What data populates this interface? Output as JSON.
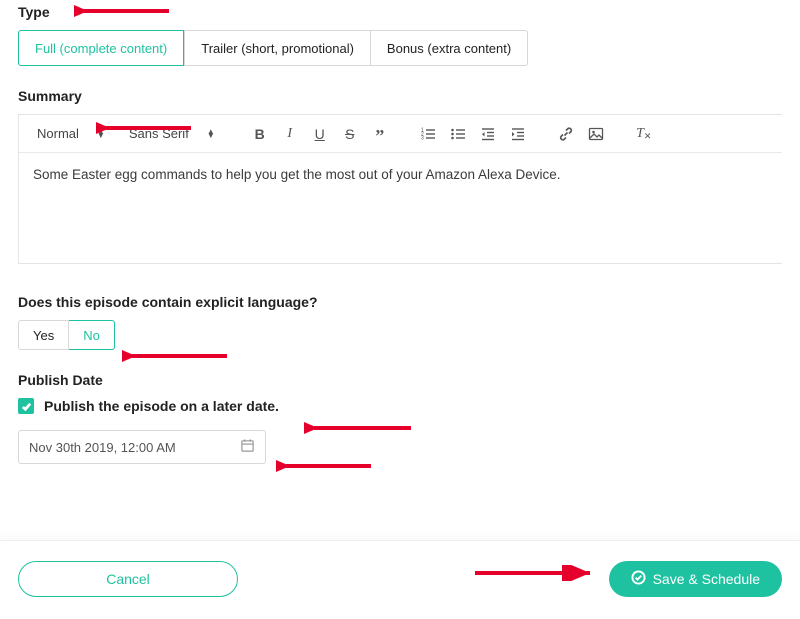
{
  "type": {
    "label": "Type",
    "options": [
      {
        "label": "Full (complete content)",
        "selected": true
      },
      {
        "label": "Trailer (short, promotional)",
        "selected": false
      },
      {
        "label": "Bonus (extra content)",
        "selected": false
      }
    ]
  },
  "summary": {
    "label": "Summary",
    "toolbar": {
      "heading": "Normal",
      "font": "Sans Serif"
    },
    "content": "Some Easter egg commands to help you get the most out of your Amazon Alexa Device."
  },
  "explicit": {
    "label": "Does this episode contain explicit language?",
    "options": [
      {
        "label": "Yes",
        "selected": false
      },
      {
        "label": "No",
        "selected": true
      }
    ]
  },
  "publish": {
    "label": "Publish Date",
    "checkbox_label": "Publish the episode on a later date.",
    "checked": true,
    "date": "Nov 30th 2019, 12:00 AM"
  },
  "footer": {
    "cancel": "Cancel",
    "save": "Save & Schedule"
  }
}
